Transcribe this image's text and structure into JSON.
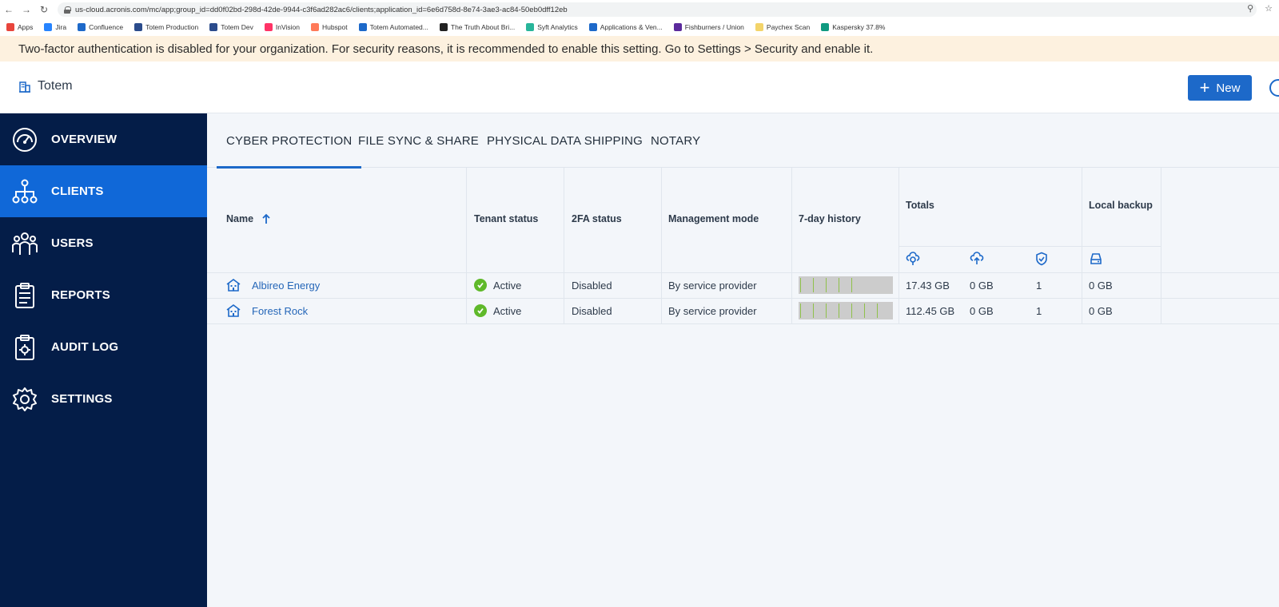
{
  "browser": {
    "url": "us-cloud.acronis.com/mc/app;group_id=dd0f02bd-298d-42de-9944-c3f6ad282ac6/clients;application_id=6e6d758d-8e74-3ae3-ac84-50eb0dff12eb",
    "bookmarks": [
      {
        "label": "Apps",
        "color": "#e8453c"
      },
      {
        "label": "Jira",
        "color": "#2684ff"
      },
      {
        "label": "Confluence",
        "color": "#1d69c9"
      },
      {
        "label": "Totem Production",
        "color": "#2b4c8c"
      },
      {
        "label": "Totem Dev",
        "color": "#2b4c8c"
      },
      {
        "label": "InVision",
        "color": "#ff3366"
      },
      {
        "label": "Hubspot",
        "color": "#ff7a59"
      },
      {
        "label": "Totem Automated...",
        "color": "#1d69c9"
      },
      {
        "label": "The Truth About Bri...",
        "color": "#222222"
      },
      {
        "label": "Syft Analytics",
        "color": "#28b59a"
      },
      {
        "label": "Applications & Ven...",
        "color": "#1d69c9"
      },
      {
        "label": "Fishburners / Union",
        "color": "#5b2a9c"
      },
      {
        "label": "Paychex Scan",
        "color": "#f3d46a"
      },
      {
        "label": "Kaspersky 37.8%",
        "color": "#109a80"
      }
    ]
  },
  "banner": {
    "text": "Two-factor authentication is disabled for your organization. For security reasons, it is recommended to enable this setting. Go to Settings > Security and enable it."
  },
  "header": {
    "org_name": "Totem",
    "new_label": "New"
  },
  "sidebar": {
    "items": [
      {
        "label": "OVERVIEW",
        "icon": "gauge-icon"
      },
      {
        "label": "CLIENTS",
        "icon": "hierarchy-icon",
        "active": true
      },
      {
        "label": "USERS",
        "icon": "users-icon"
      },
      {
        "label": "REPORTS",
        "icon": "clipboard-icon"
      },
      {
        "label": "AUDIT LOG",
        "icon": "audit-icon"
      },
      {
        "label": "SETTINGS",
        "icon": "gear-icon"
      }
    ]
  },
  "tabs": [
    "CYBER PROTECTION",
    "FILE SYNC & SHARE",
    "PHYSICAL DATA SHIPPING",
    "NOTARY"
  ],
  "table": {
    "headers": {
      "name": "Name",
      "tenant_status": "Tenant status",
      "twofa_status": "2FA status",
      "management_mode": "Management mode",
      "history": "7-day history",
      "totals": "Totals",
      "local_backup": "Local backup"
    },
    "rows": [
      {
        "name": "Albireo Energy",
        "tenant_status": "Active",
        "twofa_status": "Disabled",
        "management_mode": "By service provider",
        "total_cloud": "17.43 GB",
        "total_upload": "0 GB",
        "total_protected": "1",
        "local_backup": "0 GB",
        "history_days_with_activity": 5
      },
      {
        "name": "Forest Rock",
        "tenant_status": "Active",
        "twofa_status": "Disabled",
        "management_mode": "By service provider",
        "total_cloud": "112.45 GB",
        "total_upload": "0 GB",
        "total_protected": "1",
        "local_backup": "0 GB",
        "history_days_with_activity": 7
      }
    ]
  },
  "colors": {
    "sidebar_bg": "#041d48",
    "active_nav": "#1068d8",
    "primary": "#1d69c9",
    "success": "#5fb92a",
    "banner_bg": "#fdf1df"
  }
}
